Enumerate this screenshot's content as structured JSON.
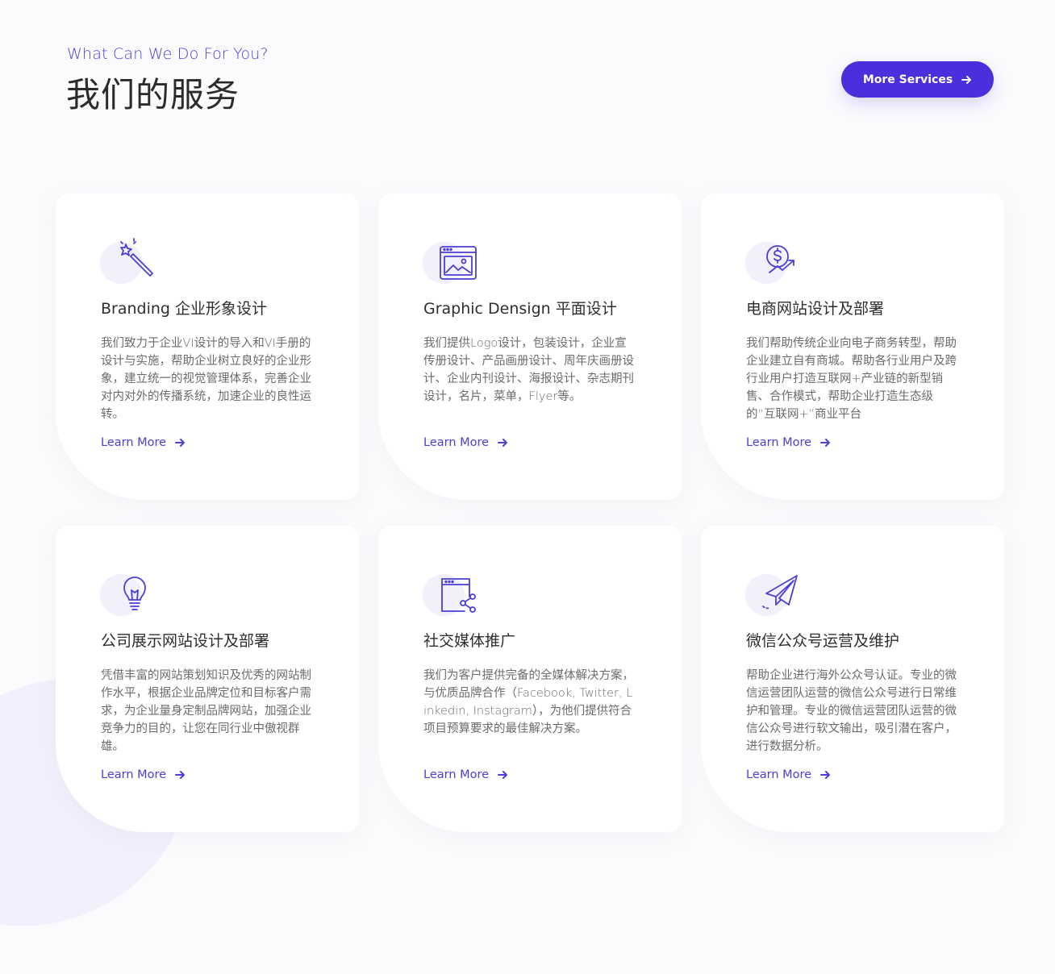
{
  "header": {
    "subtitle": "What Can We Do For You?",
    "title": "我们的服务",
    "button_label": "More Services"
  },
  "colors": {
    "accent": "#4a2fdc",
    "icon_bg": "#f1f0fb",
    "text": "#6b6b6b"
  },
  "cards": [
    {
      "icon": "magic-wand-icon",
      "title": "Branding 企业形象设计",
      "desc": "我们致力于企业VI设计的导入和VI手册的设计与实施，帮助企业树立良好的企业形象，建立统一的视觉管理体系，完善企业对内对外的传播系统，加速企业的良性运转。",
      "link": "Learn More"
    },
    {
      "icon": "image-window-icon",
      "title": "Graphic Densign 平面设计",
      "desc": "我们提供Logo设计，包装设计，企业宣传册设计、产品画册设计、周年庆画册设计、企业内刊设计、海报设计、杂志期刊设计，名片，菜单，Flyer等。",
      "link": "Learn More"
    },
    {
      "icon": "dollar-growth-icon",
      "title": "电商网站设计及部署",
      "desc": "我们帮助传统企业向电子商务转型，帮助企业建立自有商城。帮助各行业用户及跨行业用户打造互联网+产业链的新型销售、合作模式，帮助企业打造生态级的“互联网+”商业平台",
      "link": "Learn More"
    },
    {
      "icon": "lightbulb-icon",
      "title": "公司展示网站设计及部署",
      "desc": "凭借丰富的网站策划知识及优秀的网站制作水平，根据企业品牌定位和目标客户需求，为企业量身定制品牌网站，加强企业竞争力的目的，让您在同行业中傲视群雄。",
      "link": "Learn More"
    },
    {
      "icon": "share-window-icon",
      "title": "社交媒体推广",
      "desc": "我们为客户提供完备的全媒体解决方案，与优质品牌合作（Facebook, Twitter, Linkedin, Instagram），为他们提供符合项目预算要求的最佳解决方案。",
      "link": "Learn More"
    },
    {
      "icon": "paper-plane-icon",
      "title": "微信公众号运营及维护",
      "desc": "帮助企业进行海外公众号认证。专业的微信运营团队运营的微信公众号进行日常维护和管理。专业的微信运营团队运营的微信公众号进行软文输出，吸引潜在客户，进行数据分析。",
      "link": "Learn More"
    }
  ]
}
